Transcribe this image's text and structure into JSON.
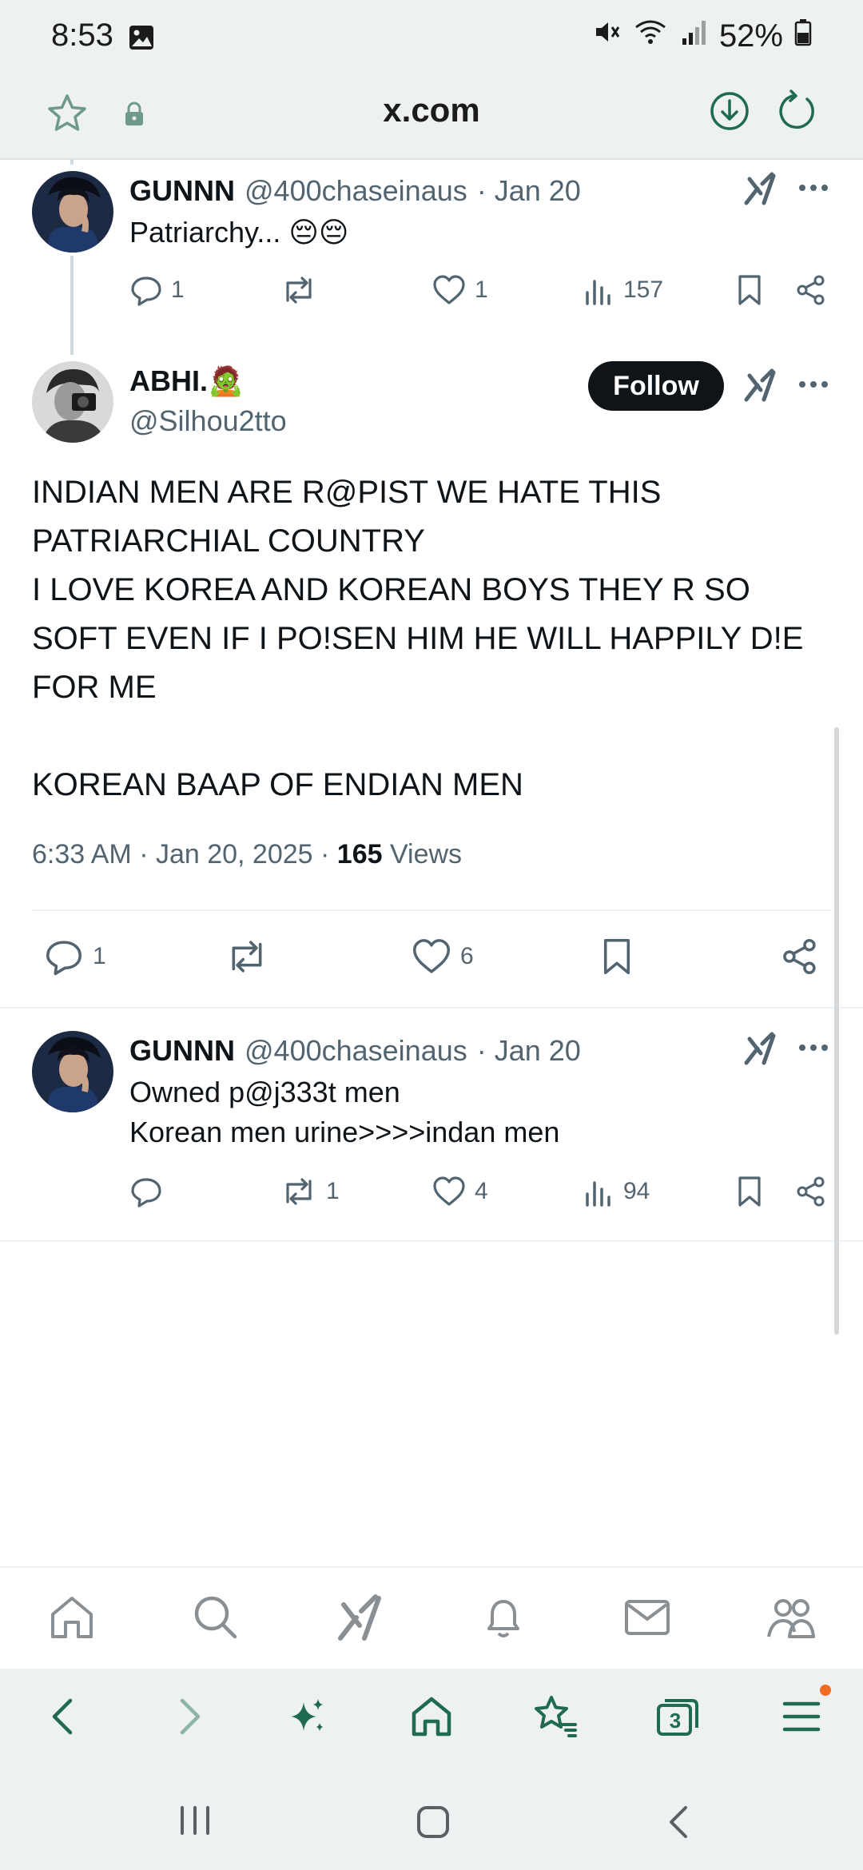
{
  "status_bar": {
    "time": "8:53",
    "battery": "52%"
  },
  "browser": {
    "url": "x.com",
    "tabs_count": "3"
  },
  "tweets": {
    "reply1": {
      "name": "GUNNN",
      "handle": "@400chaseinaus",
      "date": "· Jan 20",
      "text": "Patriarchy... 😔😔",
      "replies": "1",
      "reposts": "",
      "likes": "1",
      "views": "157"
    },
    "main": {
      "name": "ABHI.🧟",
      "handle": "@Silhou2tto",
      "follow_label": "Follow",
      "text_line1": "INDIAN MEN ARE R@PIST WE HATE THIS",
      "text_line2": "PATRIARCHIAL COUNTRY",
      "text_line3": "I LOVE KOREA AND KOREAN BOYS THEY R SO",
      "text_line4": "SOFT EVEN IF I PO!SEN HIM HE WILL HAPPILY D!E",
      "text_line5": "FOR ME",
      "text_line6": "KOREAN BAAP OF ENDIAN MEN",
      "timestamp": "6:33 AM · Jan 20, 2025 · ",
      "views_count": "165",
      "views_label": " Views",
      "replies": "1",
      "likes": "6"
    },
    "reply2": {
      "name": "GUNNN",
      "handle": "@400chaseinaus",
      "date": "· Jan 20",
      "text_line1": "Owned p@j333t men",
      "text_line2": "Korean men urine>>>>indan men",
      "replies": "",
      "reposts": "1",
      "likes": "4",
      "views": "94"
    }
  },
  "colors": {
    "accent": "#1d9bf0",
    "browser_green": "#1f6b4f",
    "text_primary": "#0f1419",
    "text_secondary": "#536471"
  },
  "icons": {
    "reply": "reply-icon",
    "repost": "repost-icon",
    "like": "heart-icon",
    "views": "views-icon",
    "bookmark": "bookmark-icon",
    "share": "share-icon",
    "grok": "grok-icon",
    "more": "more-icon"
  }
}
